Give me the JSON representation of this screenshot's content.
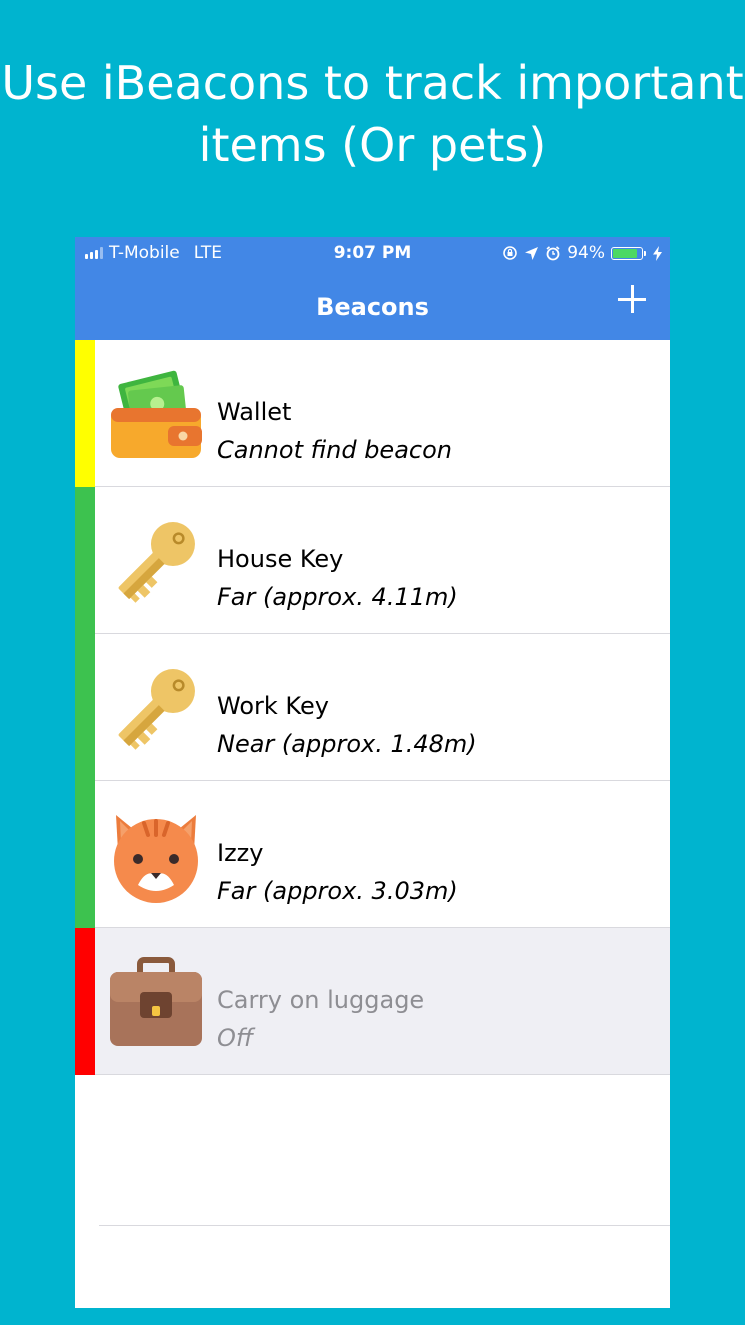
{
  "promo": {
    "line1": "Use iBeacons to track important",
    "line2": "items (Or pets)"
  },
  "status_bar": {
    "carrier": "T-Mobile",
    "network": "LTE",
    "time": "9:07 PM",
    "battery": "94%",
    "battery_level": 0.94
  },
  "nav": {
    "title": "Beacons",
    "add_icon": "plus-icon"
  },
  "colors": {
    "background": "#00b4cf",
    "nav": "#4287e6",
    "yellow": "#ffff00",
    "green": "#3dc24f",
    "red": "#ff0000"
  },
  "beacons": [
    {
      "name": "Wallet",
      "status": "Cannot find beacon",
      "icon": "wallet-icon",
      "indicator": "#ffff00"
    },
    {
      "name": "House Key",
      "status": "Far (approx. 4.11m)",
      "icon": "key-icon",
      "indicator": "#3dc24f"
    },
    {
      "name": "Work Key",
      "status": "Near (approx. 1.48m)",
      "icon": "key-icon",
      "indicator": "#3dc24f"
    },
    {
      "name": "Izzy",
      "status": "Far (approx. 3.03m)",
      "icon": "cat-icon",
      "indicator": "#3dc24f"
    },
    {
      "name": "Carry on luggage",
      "status": "Off",
      "icon": "briefcase-icon",
      "indicator": "#ff0000"
    }
  ]
}
